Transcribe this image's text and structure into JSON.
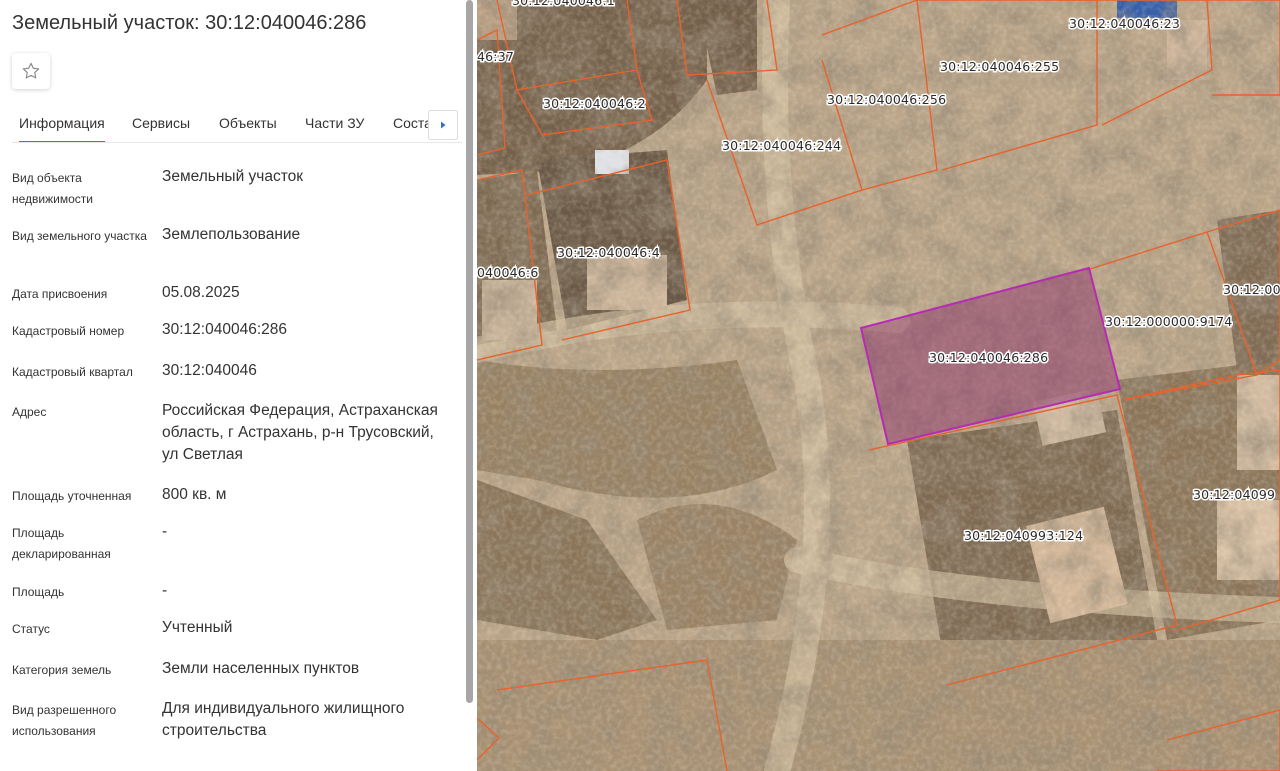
{
  "panel": {
    "title": "Земельный участок: 30:12:040046:286",
    "favorite_icon": "star-icon",
    "tabs": [
      {
        "label": "Информация",
        "active": true
      },
      {
        "label": "Сервисы"
      },
      {
        "label": "Объекты"
      },
      {
        "label": "Части ЗУ"
      },
      {
        "label": "Соста"
      }
    ],
    "next_icon": "caret-right-icon",
    "properties": [
      {
        "label": "Вид объекта недвижимости",
        "value": "Земельный участок"
      },
      {
        "label": "Вид земельного участка",
        "value": "Землепользование"
      },
      {
        "label": "Дата присвоения",
        "value": "05.08.2025"
      },
      {
        "label": "Кадастровый номер",
        "value": "30:12:040046:286"
      },
      {
        "label": "Кадастровый квартал",
        "value": "30:12:040046"
      },
      {
        "label": "Адрес",
        "value": "Российская Федерация, Астраханская область, г Астрахань, р-н Трусовский, ул Светлая"
      },
      {
        "label": "Площадь уточненная",
        "value": "800 кв. м"
      },
      {
        "label": "Площадь декларированная",
        "value": "-"
      },
      {
        "label": "Площадь",
        "value": "-"
      },
      {
        "label": "Статус",
        "value": "Учтенный"
      },
      {
        "label": "Категория земель",
        "value": "Земли населенных пунктов"
      },
      {
        "label": "Вид разрешенного использования",
        "value": "Для индивидуального жилищного строительства"
      }
    ]
  },
  "map": {
    "parcel_border_color": "#e8622c",
    "selected_fill": "#8a2a6a",
    "selected_border": "#b62bb4",
    "labels": [
      "30:12:040046:1",
      "30:12:040046:23",
      "46:37",
      "30:12:040046:255",
      "30:12:040046:256",
      "30:12:040046:2",
      "30:12:040046:244",
      "30:12:040046:4",
      "040046:6",
      "30:12:00",
      "30:12:000000:9174",
      "30:12:040046:286",
      "30:12:04099",
      "30:12:040993:124"
    ]
  }
}
